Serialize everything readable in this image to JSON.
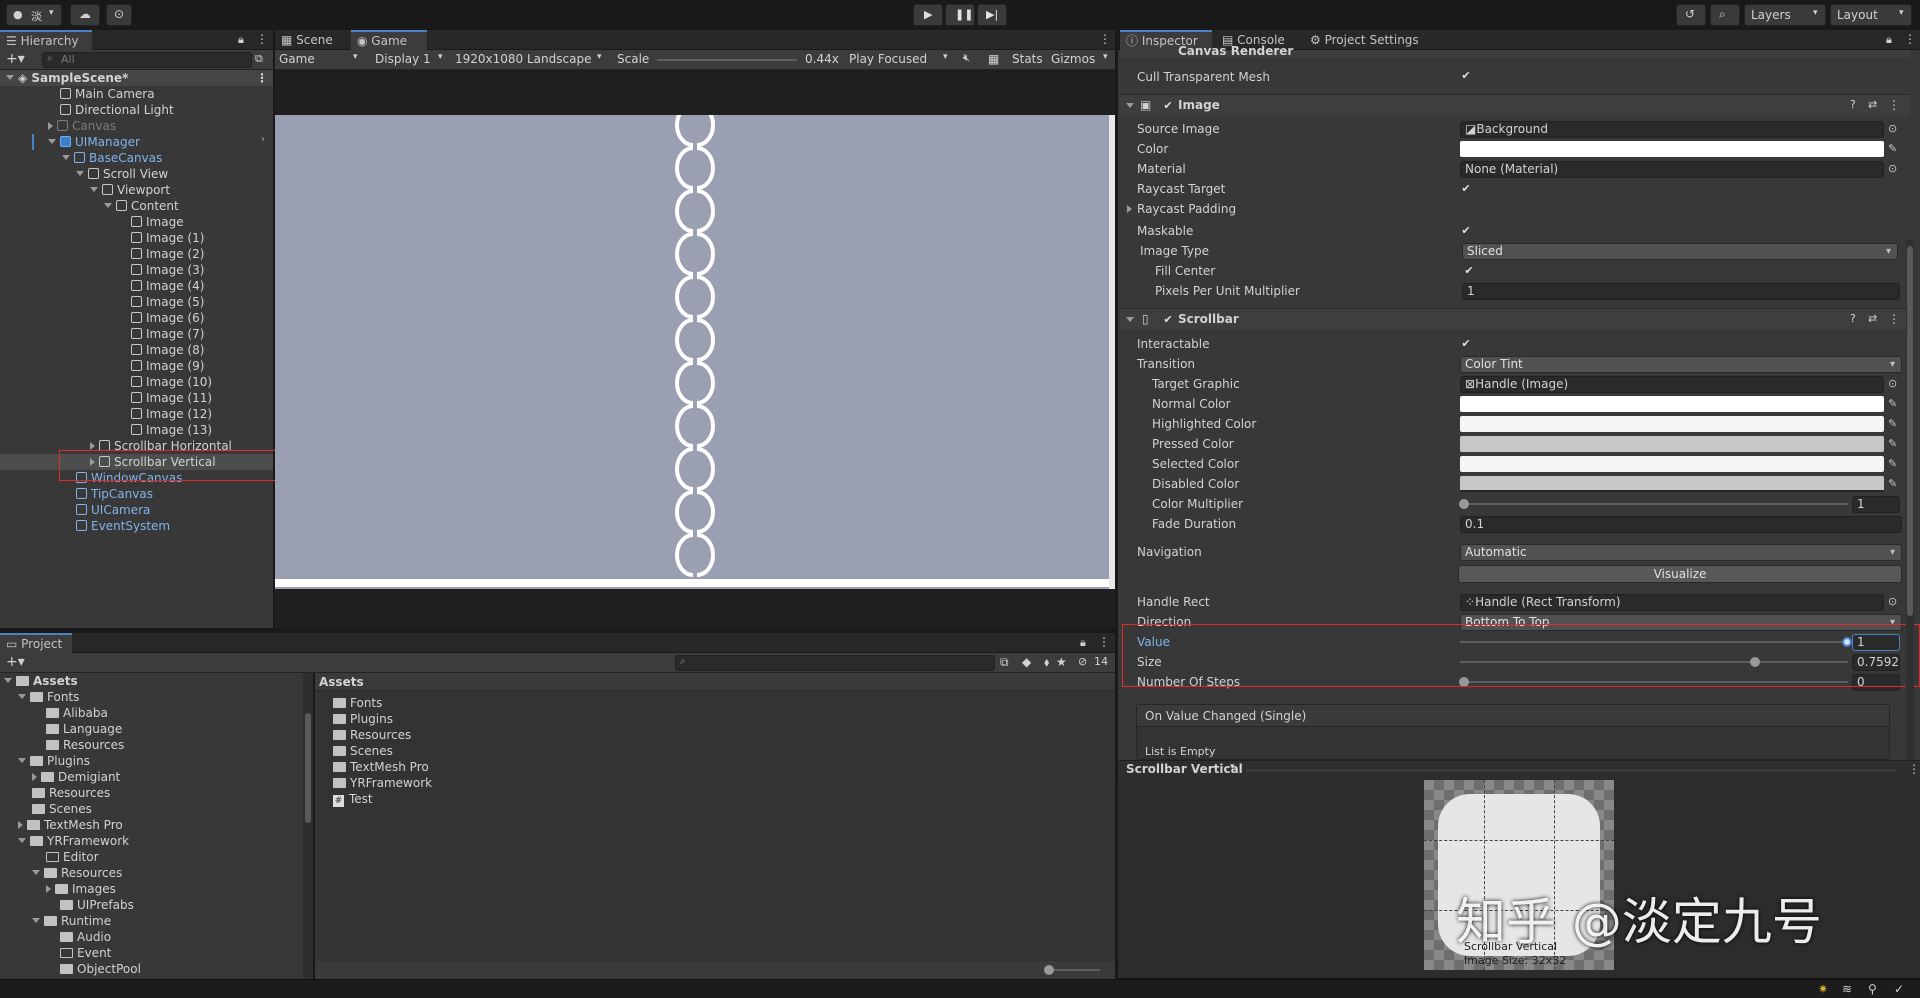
{
  "topbar": {
    "account": "淡",
    "play_icon": "play-icon",
    "pause_icon": "pause-icon",
    "step_icon": "step-icon",
    "layers": "Layers",
    "layout": "Layout"
  },
  "hierarchy": {
    "tab": "Hierarchy",
    "search_placeholder": "All",
    "scene": "SampleScene*",
    "items": [
      "Main Camera",
      "Directional Light",
      "Canvas",
      "UIManager",
      "BaseCanvas",
      "Scroll View",
      "Viewport",
      "Content",
      "Image",
      "Image (1)",
      "Image (2)",
      "Image (3)",
      "Image (4)",
      "Image (5)",
      "Image (6)",
      "Image (7)",
      "Image (8)",
      "Image (9)",
      "Image (10)",
      "Image (11)",
      "Image (12)",
      "Image (13)",
      "Scrollbar Horizontal",
      "Scrollbar Vertical",
      "WindowCanvas",
      "TipCanvas",
      "UICamera",
      "EventSystem"
    ]
  },
  "game": {
    "tabs": [
      "Scene",
      "Game"
    ],
    "toolbar": {
      "mode": "Game",
      "display": "Display 1",
      "resolution": "1920x1080 Landscape",
      "scale_label": "Scale",
      "scale_value": "0.44x",
      "play_focused": "Play Focused",
      "stats": "Stats",
      "gizmos": "Gizmos"
    }
  },
  "inspector": {
    "tabs": [
      "Inspector",
      "Console",
      "Project Settings"
    ],
    "canvas_renderer": "Canvas Renderer",
    "cull_transparent_mesh": "Cull Transparent Mesh",
    "image": {
      "title": "Image",
      "source_image_label": "Source Image",
      "source_image": "Background",
      "color_label": "Color",
      "material_label": "Material",
      "material": "None (Material)",
      "raycast_target": "Raycast Target",
      "raycast_padding": "Raycast Padding",
      "maskable": "Maskable",
      "image_type_label": "Image Type",
      "image_type": "Sliced",
      "fill_center": "Fill Center",
      "ppum_label": "Pixels Per Unit Multiplier",
      "ppum": "1"
    },
    "scrollbar": {
      "title": "Scrollbar",
      "interactable": "Interactable",
      "transition_label": "Transition",
      "transition": "Color Tint",
      "target_graphic_label": "Target Graphic",
      "target_graphic": "Handle (Image)",
      "normal_color": "Normal Color",
      "highlighted_color": "Highlighted Color",
      "pressed_color": "Pressed Color",
      "selected_color": "Selected Color",
      "disabled_color": "Disabled Color",
      "color_multiplier_label": "Color Multiplier",
      "color_multiplier": "1",
      "fade_duration_label": "Fade Duration",
      "fade_duration": "0.1",
      "navigation_label": "Navigation",
      "navigation": "Automatic",
      "visualize": "Visualize",
      "handle_rect_label": "Handle Rect",
      "handle_rect": "Handle (Rect Transform)",
      "direction_label": "Direction",
      "direction": "Bottom To Top",
      "value_label": "Value",
      "value": "1",
      "value_fraction": 1.0,
      "size_label": "Size",
      "size": "0.75928",
      "size_fraction": 0.75928,
      "steps_label": "Number Of Steps",
      "steps": "0",
      "on_value_changed": "On Value Changed (Single)",
      "list_empty": "List is Empty"
    },
    "preview": {
      "title": "Scrollbar Vertical",
      "caption1": "Scrollbar Vertical",
      "caption2": "Image Size: 32x32"
    }
  },
  "project": {
    "tab": "Project",
    "count": "14",
    "tree": [
      "Assets",
      "Fonts",
      "Alibaba",
      "Language",
      "Resources",
      "Plugins",
      "Demigiant",
      "Resources",
      "Scenes",
      "TextMesh Pro",
      "YRFramework",
      "Editor",
      "Resources",
      "Images",
      "UIPrefabs",
      "Runtime",
      "Audio",
      "Event",
      "ObjectPool"
    ],
    "breadcrumb": "Assets",
    "files": [
      "Fonts",
      "Plugins",
      "Resources",
      "Scenes",
      "TextMesh Pro",
      "YRFramework",
      "Test"
    ]
  },
  "watermark": "知乎 @淡定九号",
  "colors": {
    "accent": "#4a82c6",
    "highlight_red": "#e02b2b",
    "game_bg": "#9aa0b2"
  }
}
